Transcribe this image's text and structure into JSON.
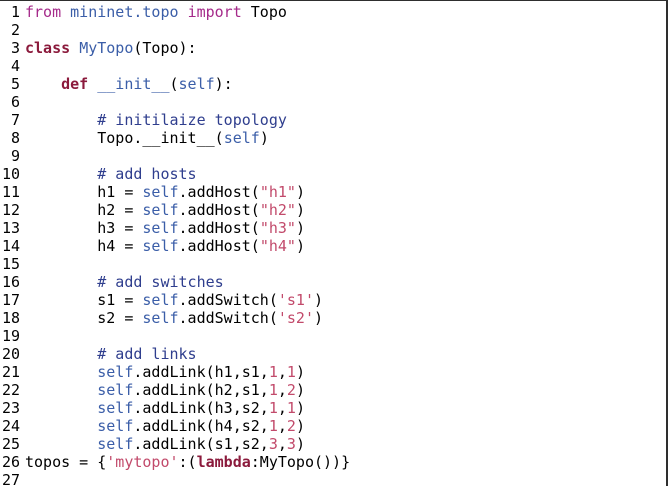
{
  "lines": [
    {
      "n": "1",
      "tokens": [
        {
          "t": "from",
          "c": "k-purple"
        },
        {
          "t": " mininet.topo ",
          "c": "k-blue"
        },
        {
          "t": "import",
          "c": "k-purple"
        },
        {
          "t": " Topo",
          "c": "k-plain"
        }
      ]
    },
    {
      "n": "2",
      "tokens": []
    },
    {
      "n": "3",
      "tokens": [
        {
          "t": "class",
          "c": "k-bold-red"
        },
        {
          "t": " ",
          "c": "k-plain"
        },
        {
          "t": "MyTopo",
          "c": "k-blue"
        },
        {
          "t": "(Topo):",
          "c": "k-plain"
        }
      ]
    },
    {
      "n": "4",
      "tokens": []
    },
    {
      "n": "5",
      "tokens": [
        {
          "t": "    ",
          "c": "k-plain"
        },
        {
          "t": "def",
          "c": "k-bold-red"
        },
        {
          "t": " ",
          "c": "k-plain"
        },
        {
          "t": "__init__",
          "c": "k-blue"
        },
        {
          "t": "(",
          "c": "k-plain"
        },
        {
          "t": "self",
          "c": "k-blue"
        },
        {
          "t": "):",
          "c": "k-plain"
        }
      ]
    },
    {
      "n": "6",
      "tokens": []
    },
    {
      "n": "7",
      "tokens": [
        {
          "t": "        # initilaize topology",
          "c": "k-comment"
        }
      ]
    },
    {
      "n": "8",
      "tokens": [
        {
          "t": "        Topo.__init__(",
          "c": "k-plain"
        },
        {
          "t": "self",
          "c": "k-blue"
        },
        {
          "t": ")",
          "c": "k-plain"
        }
      ]
    },
    {
      "n": "9",
      "tokens": []
    },
    {
      "n": "10",
      "tokens": [
        {
          "t": "        # add hosts",
          "c": "k-comment"
        }
      ]
    },
    {
      "n": "11",
      "tokens": [
        {
          "t": "        h1 = ",
          "c": "k-plain"
        },
        {
          "t": "self",
          "c": "k-blue"
        },
        {
          "t": ".addHost(",
          "c": "k-plain"
        },
        {
          "t": "\"h1\"",
          "c": "k-str"
        },
        {
          "t": ")",
          "c": "k-plain"
        }
      ]
    },
    {
      "n": "12",
      "tokens": [
        {
          "t": "        h2 = ",
          "c": "k-plain"
        },
        {
          "t": "self",
          "c": "k-blue"
        },
        {
          "t": ".addHost(",
          "c": "k-plain"
        },
        {
          "t": "\"h2\"",
          "c": "k-str"
        },
        {
          "t": ")",
          "c": "k-plain"
        }
      ]
    },
    {
      "n": "13",
      "tokens": [
        {
          "t": "        h3 = ",
          "c": "k-plain"
        },
        {
          "t": "self",
          "c": "k-blue"
        },
        {
          "t": ".addHost(",
          "c": "k-plain"
        },
        {
          "t": "\"h3\"",
          "c": "k-str"
        },
        {
          "t": ")",
          "c": "k-plain"
        }
      ]
    },
    {
      "n": "14",
      "tokens": [
        {
          "t": "        h4 = ",
          "c": "k-plain"
        },
        {
          "t": "self",
          "c": "k-blue"
        },
        {
          "t": ".addHost(",
          "c": "k-plain"
        },
        {
          "t": "\"h4\"",
          "c": "k-str"
        },
        {
          "t": ")",
          "c": "k-plain"
        }
      ]
    },
    {
      "n": "15",
      "tokens": []
    },
    {
      "n": "16",
      "tokens": [
        {
          "t": "        # add switches",
          "c": "k-comment"
        }
      ]
    },
    {
      "n": "17",
      "tokens": [
        {
          "t": "        s1 = ",
          "c": "k-plain"
        },
        {
          "t": "self",
          "c": "k-blue"
        },
        {
          "t": ".addSwitch(",
          "c": "k-plain"
        },
        {
          "t": "'s1'",
          "c": "k-str"
        },
        {
          "t": ")",
          "c": "k-plain"
        }
      ]
    },
    {
      "n": "18",
      "tokens": [
        {
          "t": "        s2 = ",
          "c": "k-plain"
        },
        {
          "t": "self",
          "c": "k-blue"
        },
        {
          "t": ".addSwitch(",
          "c": "k-plain"
        },
        {
          "t": "'s2'",
          "c": "k-str"
        },
        {
          "t": ")",
          "c": "k-plain"
        }
      ]
    },
    {
      "n": "19",
      "tokens": []
    },
    {
      "n": "20",
      "tokens": [
        {
          "t": "        # add links",
          "c": "k-comment"
        }
      ]
    },
    {
      "n": "21",
      "tokens": [
        {
          "t": "        ",
          "c": "k-plain"
        },
        {
          "t": "self",
          "c": "k-blue"
        },
        {
          "t": ".addLink(h1,s1,",
          "c": "k-plain"
        },
        {
          "t": "1",
          "c": "k-num"
        },
        {
          "t": ",",
          "c": "k-plain"
        },
        {
          "t": "1",
          "c": "k-num"
        },
        {
          "t": ")",
          "c": "k-plain"
        }
      ]
    },
    {
      "n": "22",
      "tokens": [
        {
          "t": "        ",
          "c": "k-plain"
        },
        {
          "t": "self",
          "c": "k-blue"
        },
        {
          "t": ".addLink(h2,s1,",
          "c": "k-plain"
        },
        {
          "t": "1",
          "c": "k-num"
        },
        {
          "t": ",",
          "c": "k-plain"
        },
        {
          "t": "2",
          "c": "k-num"
        },
        {
          "t": ")",
          "c": "k-plain"
        }
      ]
    },
    {
      "n": "23",
      "tokens": [
        {
          "t": "        ",
          "c": "k-plain"
        },
        {
          "t": "self",
          "c": "k-blue"
        },
        {
          "t": ".addLink(h3,s2,",
          "c": "k-plain"
        },
        {
          "t": "1",
          "c": "k-num"
        },
        {
          "t": ",",
          "c": "k-plain"
        },
        {
          "t": "1",
          "c": "k-num"
        },
        {
          "t": ")",
          "c": "k-plain"
        }
      ]
    },
    {
      "n": "24",
      "tokens": [
        {
          "t": "        ",
          "c": "k-plain"
        },
        {
          "t": "self",
          "c": "k-blue"
        },
        {
          "t": ".addLink(h4,s2,",
          "c": "k-plain"
        },
        {
          "t": "1",
          "c": "k-num"
        },
        {
          "t": ",",
          "c": "k-plain"
        },
        {
          "t": "2",
          "c": "k-num"
        },
        {
          "t": ")",
          "c": "k-plain"
        }
      ]
    },
    {
      "n": "25",
      "tokens": [
        {
          "t": "        ",
          "c": "k-plain"
        },
        {
          "t": "self",
          "c": "k-blue"
        },
        {
          "t": ".addLink(s1,s2,",
          "c": "k-plain"
        },
        {
          "t": "3",
          "c": "k-num"
        },
        {
          "t": ",",
          "c": "k-plain"
        },
        {
          "t": "3",
          "c": "k-num"
        },
        {
          "t": ")",
          "c": "k-plain"
        }
      ]
    },
    {
      "n": "26",
      "tokens": [
        {
          "t": "topos = {",
          "c": "k-plain"
        },
        {
          "t": "'mytopo'",
          "c": "k-str"
        },
        {
          "t": ":(",
          "c": "k-plain"
        },
        {
          "t": "lambda",
          "c": "k-bold-red"
        },
        {
          "t": ":MyTopo())}",
          "c": "k-plain"
        }
      ]
    },
    {
      "n": "27",
      "tokens": []
    }
  ],
  "colors": {
    "keyword_purple": "#a52a8a",
    "keyword_bold": "#8b1a3c",
    "identifier_blue": "#3b5ea8",
    "string_pink": "#c24a6b",
    "comment_blue": "#2f3e8e"
  }
}
